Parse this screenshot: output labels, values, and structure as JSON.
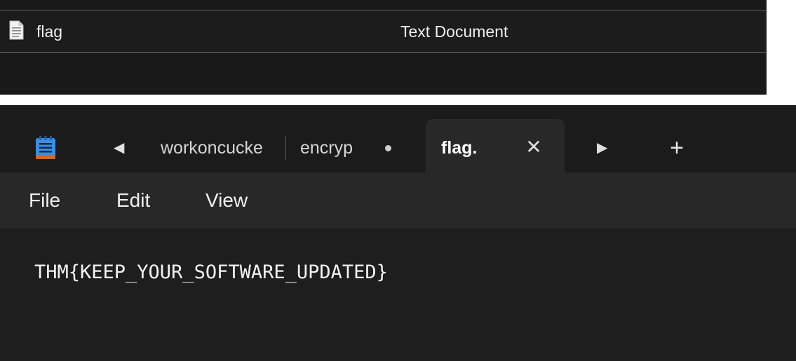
{
  "explorer": {
    "file_name": "flag",
    "file_type": "Text Document",
    "file_icon": "text-document-icon"
  },
  "notepad": {
    "app_icon": "notepad-icon",
    "tabs": [
      {
        "label": "workoncucke",
        "active": false,
        "modified": false
      },
      {
        "label": "encryp",
        "active": false,
        "modified": true
      },
      {
        "label": "flag.txt",
        "active": true,
        "modified": false
      }
    ],
    "scroll_left_glyph": "◀",
    "scroll_right_glyph": "▶",
    "close_glyph": "✕",
    "new_tab_glyph": "+",
    "menu": {
      "file": "File",
      "edit": "Edit",
      "view": "View"
    },
    "content": "THM{KEEP_YOUR_SOFTWARE_UPDATED}"
  },
  "colors": {
    "explorer_bg": "#191919",
    "tabbar_bg": "#1b1b1b",
    "active_tab_bg": "#282828",
    "editor_bg": "#1e1e1e",
    "notepad_accent": "#3b8ee0"
  }
}
